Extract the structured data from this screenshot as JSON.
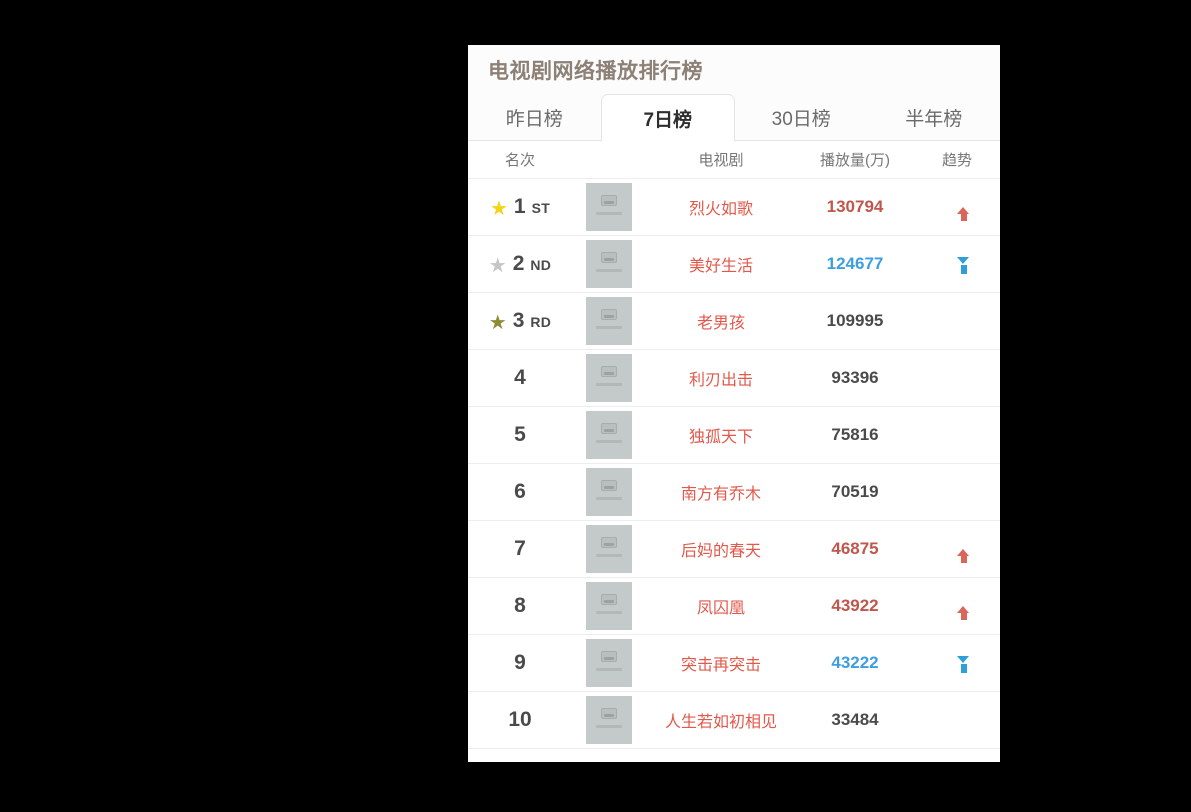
{
  "card": {
    "title": "电视剧网络播放排行榜"
  },
  "tabs": [
    {
      "label": "昨日榜",
      "active": false
    },
    {
      "label": "7日榜",
      "active": true
    },
    {
      "label": "30日榜",
      "active": false
    },
    {
      "label": "半年榜",
      "active": false
    }
  ],
  "columns": {
    "rank": "名次",
    "drama": "电视剧",
    "plays": "播放量(万)",
    "trend": "趋势"
  },
  "colors": {
    "drama_name": "#e2584a",
    "plays_up": "#c0564c",
    "plays_down": "#3d9ee0",
    "plays_flat": "#4a4a4a",
    "arrow_up": "#d9655b",
    "arrow_down": "#2e9fd8",
    "arrow_flat": "#5c5c5c",
    "star_gold": "#f5d316",
    "star_silver": "#c6c6c6",
    "star_bronze": "#8f8b35",
    "title": "#8d8077"
  },
  "rows": [
    {
      "rank": "1",
      "suffix": "ST",
      "star": "gold",
      "thumb_icon": "broken-image-icon",
      "name": "烈火如歌",
      "plays": "130794",
      "plays_state": "up",
      "trend": "up"
    },
    {
      "rank": "2",
      "suffix": "ND",
      "star": "silver",
      "thumb_icon": "broken-image-icon",
      "name": "美好生活",
      "plays": "124677",
      "plays_state": "down",
      "trend": "down"
    },
    {
      "rank": "3",
      "suffix": "RD",
      "star": "bronze",
      "thumb_icon": "broken-image-icon",
      "name": "老男孩",
      "plays": "109995",
      "plays_state": "flat",
      "trend": "flat"
    },
    {
      "rank": "4",
      "suffix": "",
      "star": "",
      "thumb_icon": "broken-image-icon",
      "name": "利刃出击",
      "plays": "93396",
      "plays_state": "flat",
      "trend": "flat"
    },
    {
      "rank": "5",
      "suffix": "",
      "star": "",
      "thumb_icon": "broken-image-icon",
      "name": "独孤天下",
      "plays": "75816",
      "plays_state": "flat",
      "trend": "flat"
    },
    {
      "rank": "6",
      "suffix": "",
      "star": "",
      "thumb_icon": "broken-image-icon",
      "name": "南方有乔木",
      "plays": "70519",
      "plays_state": "flat",
      "trend": "flat"
    },
    {
      "rank": "7",
      "suffix": "",
      "star": "",
      "thumb_icon": "broken-image-icon",
      "name": "后妈的春天",
      "plays": "46875",
      "plays_state": "up",
      "trend": "up"
    },
    {
      "rank": "8",
      "suffix": "",
      "star": "",
      "thumb_icon": "broken-image-icon",
      "name": "凤囚凰",
      "plays": "43922",
      "plays_state": "up",
      "trend": "up"
    },
    {
      "rank": "9",
      "suffix": "",
      "star": "",
      "thumb_icon": "broken-image-icon",
      "name": "突击再突击",
      "plays": "43222",
      "plays_state": "down",
      "trend": "down"
    },
    {
      "rank": "10",
      "suffix": "",
      "star": "",
      "thumb_icon": "broken-image-icon",
      "name": "人生若如初相见",
      "plays": "33484",
      "plays_state": "flat",
      "trend": "flat"
    }
  ]
}
